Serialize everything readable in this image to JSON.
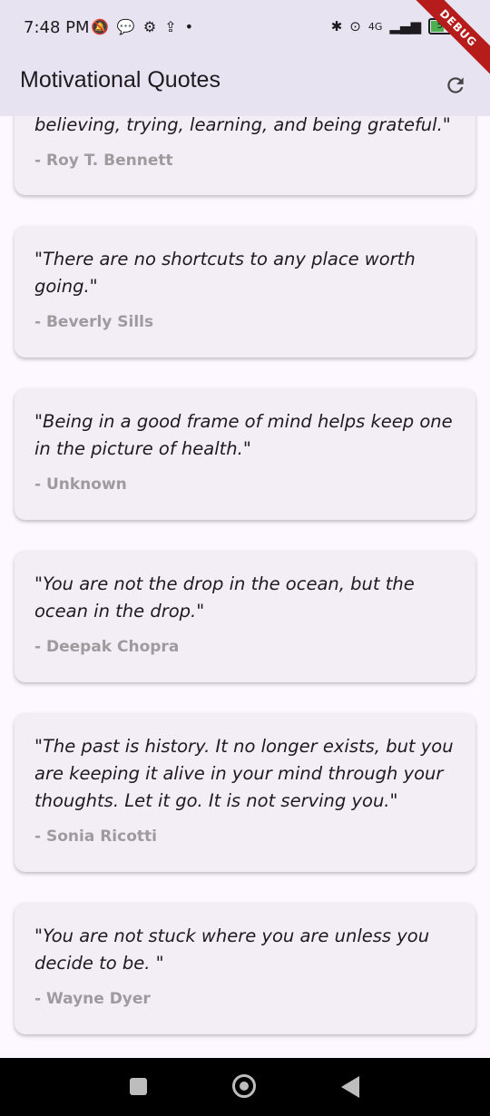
{
  "status_bar": {
    "time": "7:48 PM",
    "battery_level": "50",
    "network": "4G"
  },
  "debug_banner": "DEBUG",
  "app_bar": {
    "title": "Motivational Quotes",
    "refresh_icon": "refresh-icon"
  },
  "quotes": [
    {
      "quote": "believing, trying, learning, and being grateful.\"",
      "author": "- Roy T. Bennett"
    },
    {
      "quote": "\"There are no shortcuts to any place worth going.\"",
      "author": "- Beverly Sills"
    },
    {
      "quote": "\"Being in a good frame of mind helps keep one in the picture of health.\"",
      "author": "- Unknown"
    },
    {
      "quote": "\"You are not the drop in the ocean, but the ocean in the drop.\"",
      "author": "- Deepak Chopra"
    },
    {
      "quote": "\"The past is history. It no longer exists, but you are keeping it alive in your mind through your thoughts.  Let it go. It is not serving you.\"",
      "author": "- Sonia Ricotti"
    },
    {
      "quote": "\"You are not stuck where you are unless you decide to be.  \"",
      "author": "- Wayne Dyer"
    }
  ],
  "colors": {
    "background": "#FDF7FF",
    "card": "#F3EEF6",
    "author_text": "#9E9A9E"
  }
}
